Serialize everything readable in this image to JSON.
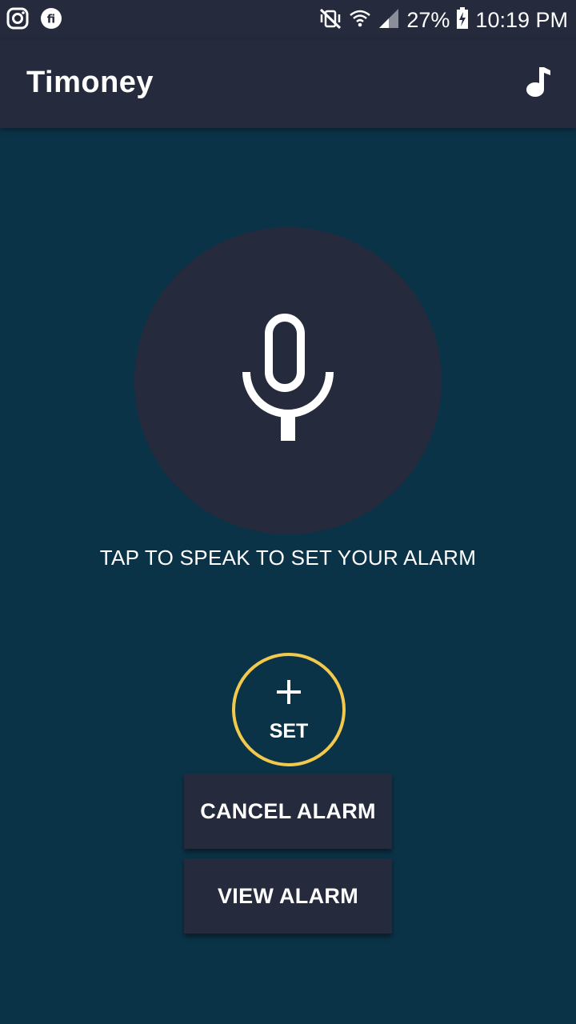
{
  "status_bar": {
    "left_icons": [
      "instagram-icon",
      "fi-icon"
    ],
    "battery_percent": "27%",
    "time": "10:19 PM",
    "right_icons": [
      "vibrate-mute-icon",
      "wifi-icon",
      "signal-icon",
      "battery-charging-icon"
    ]
  },
  "app_bar": {
    "title": "Timoney",
    "action_icon": "music-note-icon"
  },
  "main": {
    "mic_icon": "microphone-icon",
    "prompt": "TAP TO SPEAK TO SET YOUR ALARM",
    "set_button_label": "SET",
    "cancel_button_label": "CANCEL ALARM",
    "view_button_label": "VIEW ALARM"
  },
  "colors": {
    "background": "#0b3347",
    "surface": "#252a3c",
    "accent": "#f2c94c",
    "text": "#ffffff"
  }
}
